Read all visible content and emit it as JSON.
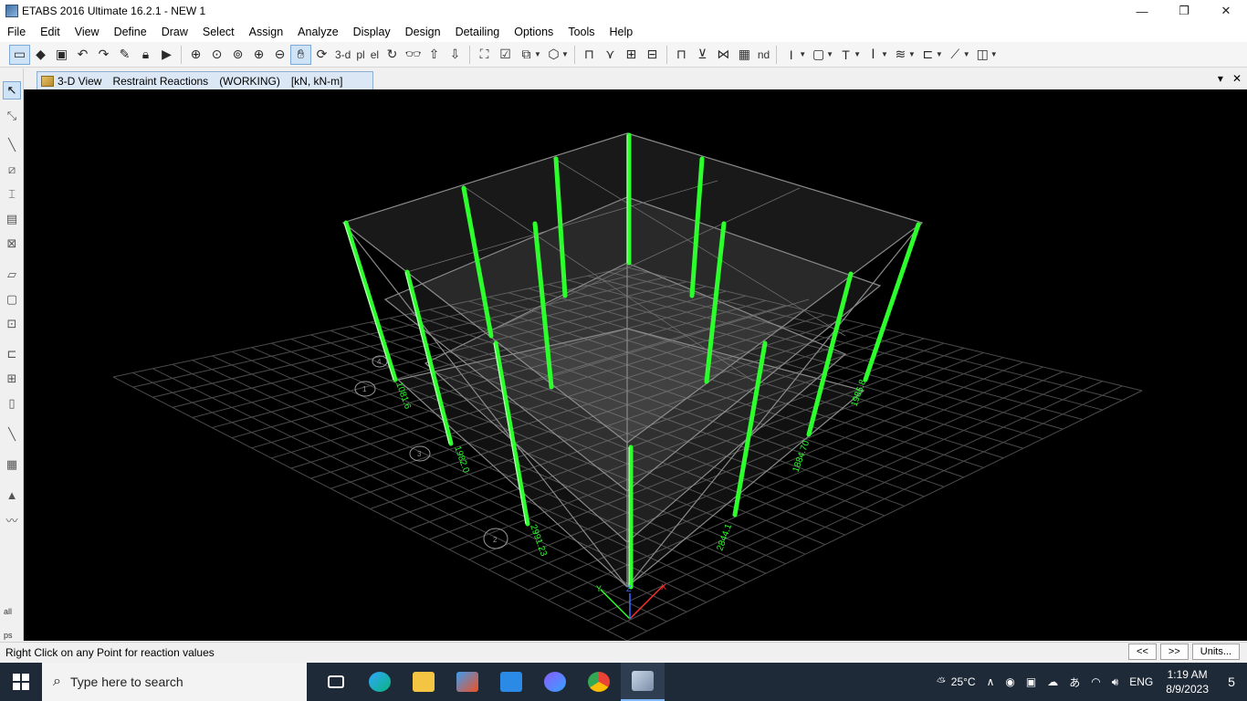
{
  "window": {
    "title": "ETABS 2016 Ultimate 16.2.1 - NEW 1",
    "minimize": "—",
    "maximize": "❐",
    "close": "✕"
  },
  "menu": [
    "File",
    "Edit",
    "View",
    "Define",
    "Draw",
    "Select",
    "Assign",
    "Analyze",
    "Display",
    "Design",
    "Detailing",
    "Options",
    "Tools",
    "Help"
  ],
  "toolbar": {
    "view_3d": "3-d",
    "view_plan": "pl",
    "view_elev": "el",
    "view_nd": "nd"
  },
  "lefttool": {
    "all_label": "all",
    "ps_label": "ps"
  },
  "tab": {
    "view": "3-D View",
    "display": "Restraint Reactions",
    "state": "(WORKING)",
    "units": "[kN, kN-m]",
    "dropdown": "▾",
    "close": "✕"
  },
  "model": {
    "reaction_labels": [
      "1081.6",
      "1982.0",
      "2991.23",
      "2844.1",
      "1884.70",
      "1986.8"
    ],
    "point_labels": [
      "1",
      "3",
      "2",
      "4"
    ],
    "axis_labels": {
      "x": "X",
      "y": "Y",
      "z": "Z"
    }
  },
  "status": {
    "text": "Right Click on any Point for reaction values",
    "prev": "<<",
    "next": ">>",
    "units": "Units..."
  },
  "taskbar": {
    "search_placeholder": "Type here to search",
    "weather": "25°C",
    "language": "ENG",
    "time": "1:19 AM",
    "date": "8/9/2023",
    "notifications": "5"
  },
  "colors": {
    "column": "#2dff2d",
    "grid": "#4a4a4a",
    "background": "#000000",
    "taskbar": "#1f2a38"
  }
}
